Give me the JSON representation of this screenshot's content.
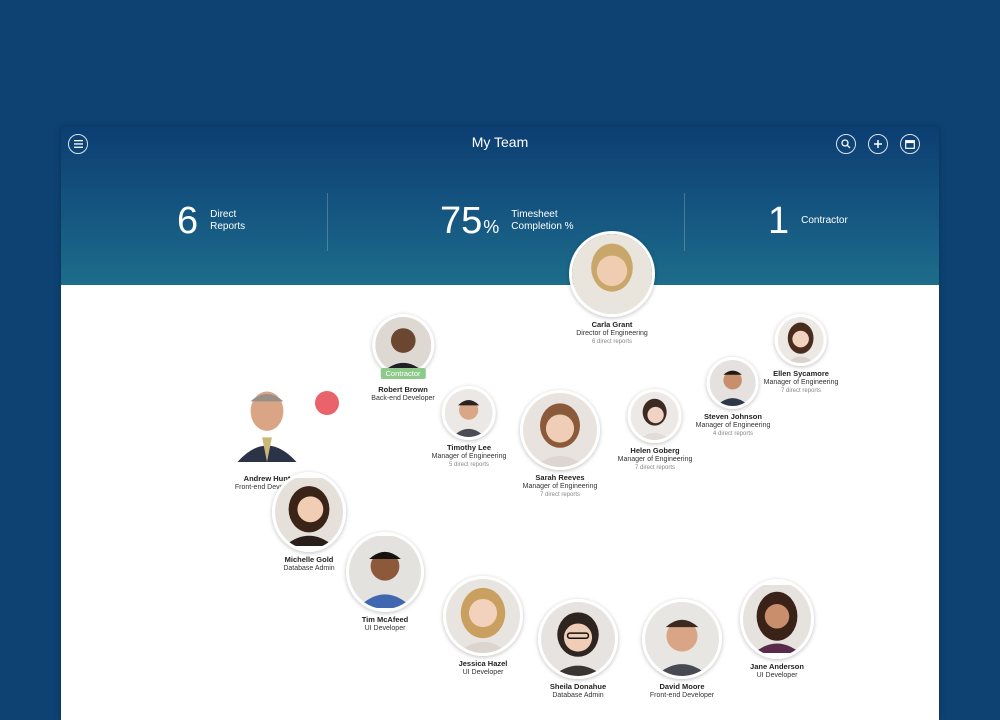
{
  "header": {
    "title": "My Team",
    "stats": [
      {
        "value": "6",
        "label_line1": "Direct",
        "label_line2": "Reports"
      },
      {
        "value": "75",
        "suffix": "%",
        "label_line1": "Timesheet",
        "label_line2": "Completion %"
      },
      {
        "value": "1",
        "label_line1": "Contractor",
        "label_line2": ""
      }
    ],
    "buttons": {
      "menu": "menu-icon",
      "search": "search-icon",
      "add": "plus-icon",
      "calendar": "calendar-icon"
    }
  },
  "people": [
    {
      "name": "Carla Grant",
      "role": "Director of Engineering",
      "reports": "6 direct reports"
    },
    {
      "name": "Robert Brown",
      "role": "Back-end Developer",
      "badge": "Contractor"
    },
    {
      "name": "Ellen Sycamore",
      "role": "Manager of Engineering",
      "reports": "7 direct reports"
    },
    {
      "name": "Steven Johnson",
      "role": "Manager of Engineering",
      "reports": "4 direct reports"
    },
    {
      "name": "Andrew Hunt",
      "role": "Front-end Developer"
    },
    {
      "name": "Timothy Lee",
      "role": "Manager of Engineering",
      "reports": "5 direct reports"
    },
    {
      "name": "Sarah Reeves",
      "role": "Manager of Engineering",
      "reports": "7 direct reports"
    },
    {
      "name": "Helen Goberg",
      "role": "Manager of Engineering",
      "reports": "7 direct reports"
    },
    {
      "name": "Michelle Gold",
      "role": "Database Admin"
    },
    {
      "name": "Tim McAfeed",
      "role": "UI Developer"
    },
    {
      "name": "Jessica Hazel",
      "role": "UI Developer"
    },
    {
      "name": "Sheila Donahue",
      "role": "Database Admin"
    },
    {
      "name": "David Moore",
      "role": "Front-end Developer"
    },
    {
      "name": "Jane Anderson",
      "role": "UI Developer"
    }
  ]
}
